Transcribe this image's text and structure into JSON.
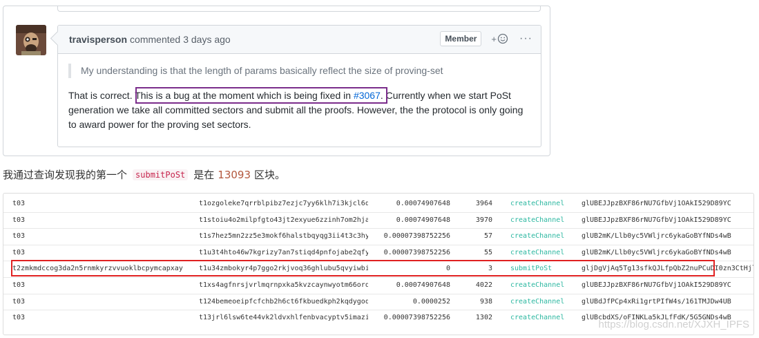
{
  "comment": {
    "author": "travisperson",
    "action": "commented",
    "time": "3 days ago",
    "badge": "Member",
    "reaction_plus": "+",
    "more": "···",
    "quote": "My understanding is that the length of params basically reflect the size of proving-set",
    "body_prefix": "That is correct. ",
    "body_highlight_text": "This is a bug at the moment which is being fixed in ",
    "body_link": "#3067",
    "body_period": ".",
    "body_rest": " Currently when we start PoSt generation we take all committed sectors and submit all the proofs. However, the the protocol is only going to award power for the proving set sectors."
  },
  "blog": {
    "text_before": "我通过查询发现我的第一个",
    "code": "submitPoSt",
    "text_middle": "是在",
    "block_number": "13093",
    "text_after": "区块。"
  },
  "transactions": {
    "rows": [
      {
        "from": "t03",
        "to": "t1ozgoleke7qrrblpibz7ezjc7yy6klh7i3kjcl6q",
        "value": "0.00074907648",
        "nonce": "3964",
        "method": "createChannel",
        "sig": "glUBEJJpzBXF86rNU7GfbVj1OAkI529D89YC"
      },
      {
        "from": "t03",
        "to": "t1stoiu4o2milpfgto43jt2exyue6zzinh7om2hja",
        "value": "0.00074907648",
        "nonce": "3970",
        "method": "createChannel",
        "sig": "glUBEJJpzBXF86rNU7GfbVj1OAkI529D89YC"
      },
      {
        "from": "t03",
        "to": "t1s7hez5mn2zz5e3mokf6halstbqyqg3ii4t3c3hy",
        "value": "0.00007398752256",
        "nonce": "57",
        "method": "createChannel",
        "sig": "glUB2mK/Llb0yc5VWljrc6ykaGoBYfNDs4wB"
      },
      {
        "from": "t03",
        "to": "t1u3t4hto46w7kgrizy7an7stiqd4pnfojabe2qfy",
        "value": "0.00007398752256",
        "nonce": "55",
        "method": "createChannel",
        "sig": "glUB2mK/Llb0yc5VWljrc6ykaGoBYfNDs4wB"
      },
      {
        "from": "t2zmkmdccog3da2n5rnmkyrzvvuoklbcpymcapxay",
        "to": "t1u34zmbokyr4p7ggo2rkjvoq36ghlubu5qvyiwbi",
        "value": "0",
        "nonce": "3",
        "method": "submitPoSt",
        "sig": "gljDgVjAq5Tg13sfkQJLfpQbZ2nuPCuDI0zn3CtHjl"
      },
      {
        "from": "t03",
        "to": "t1xs4agfnrsjvrlmqrnpxka5kvzcaynwyotm66orq",
        "value": "0.00074907648",
        "nonce": "4022",
        "method": "createChannel",
        "sig": "glUBEJJpzBXF86rNU7GfbVj1OAkI529D89YC"
      },
      {
        "from": "t03",
        "to": "t124bemeoeipfcfchb2h6ct6fkbuedkph2kqdygoq",
        "value": "0.0000252",
        "nonce": "938",
        "method": "createChannel",
        "sig": "glUBdJfPCp4xRi1grtPIfW4s/161TMJDw4UB"
      },
      {
        "from": "t03",
        "to": "t13jrl6lsw6te44vk2ldvxhlfenbvacyptv5imazi",
        "value": "0.00007398752256",
        "nonce": "1302",
        "method": "createChannel",
        "sig": "glUBcbdXS/oFINKLa5kJLfFdK/5G5GNDs4wB"
      }
    ]
  },
  "watermark": "https://blog.csdn.net/XJXH_IPFS",
  "colors": {
    "highlight_purple": "#7a2c8b",
    "highlight_red": "#e02020",
    "link": "#0366d6",
    "method_teal": "#2bb7a0"
  }
}
